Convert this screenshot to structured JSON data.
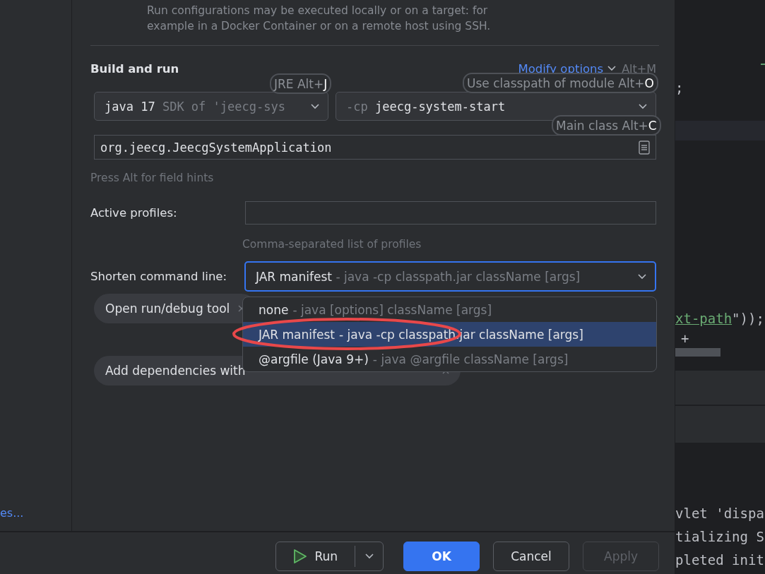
{
  "sidebar": {
    "link": "es..."
  },
  "description": [
    "Run configurations may be executed locally or on a target: for",
    "example in a Docker Container or on a remote host using SSH."
  ],
  "section": {
    "title": "Build and run",
    "modify_link": "Modify options",
    "modify_shortcut": "Alt+M"
  },
  "jre": {
    "value": "java 17",
    "detail": "SDK of 'jeecg-sys"
  },
  "classpath": {
    "prefix": "-cp",
    "value": "jeecg-system-start"
  },
  "main_class": {
    "value": "org.jeecg.JeecgSystemApplication"
  },
  "field_hint": "Press Alt for field hints",
  "hints": [
    {
      "label": "JRE Alt+",
      "key": "J"
    },
    {
      "label": "Use classpath of module Alt+",
      "key": "O"
    },
    {
      "label": "Main class Alt+",
      "key": "C"
    }
  ],
  "active_profiles": {
    "label": "Active profiles:",
    "hint": "Comma-separated list of profiles"
  },
  "shorten": {
    "label": "Shorten command line:",
    "value": "JAR manifest",
    "detail": "- java -cp classpath.jar className [args]",
    "expanded": true
  },
  "options": [
    {
      "name": "none",
      "detail": "- java [options] className [args]",
      "selected": false
    },
    {
      "name": "JAR manifest",
      "detail": "- java -cp classpath.jar className [args]",
      "selected": true
    },
    {
      "name": "@argfile (Java 9+)",
      "detail": "- java @argfile className [args]",
      "selected": false
    }
  ],
  "chips": [
    {
      "label": "Open run/debug tool"
    },
    {
      "label": "Add dependencies with"
    }
  ],
  "editor": {
    "lines": [
      {
        "parts": [
          {
            "kind": "plain",
            "text": ";"
          }
        ]
      },
      {
        "parts": [
          {
            "kind": "string",
            "text": "xt-path"
          },
          {
            "kind": "plain",
            "text": "\"));"
          }
        ]
      },
      {
        "parts": [
          {
            "kind": "plain",
            "text": "+"
          }
        ]
      }
    ]
  },
  "console": [
    "vlet 'dispa",
    "tializing S",
    "pleted init"
  ],
  "run_button": {
    "label": "Run"
  },
  "buttons": [
    {
      "label": "OK",
      "kind": "primary",
      "disabled": false
    },
    {
      "label": "Cancel",
      "kind": "normal",
      "disabled": false
    },
    {
      "label": "Apply",
      "kind": "normal",
      "disabled": true
    }
  ]
}
